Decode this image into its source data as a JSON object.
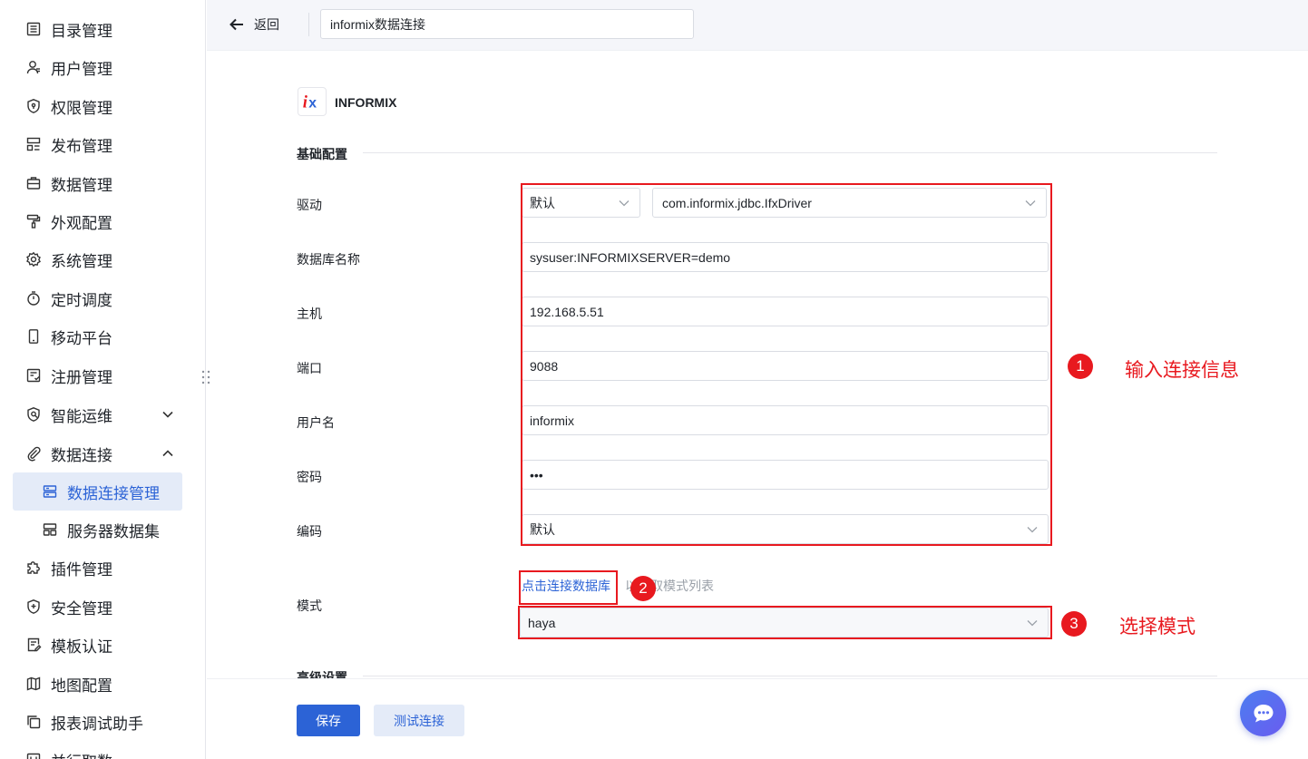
{
  "sidebar": {
    "items": [
      {
        "label": "目录管理",
        "icon": "list-icon"
      },
      {
        "label": "用户管理",
        "icon": "user-icon"
      },
      {
        "label": "权限管理",
        "icon": "shield-icon"
      },
      {
        "label": "发布管理",
        "icon": "layout-icon"
      },
      {
        "label": "数据管理",
        "icon": "briefcase-icon"
      },
      {
        "label": "外观配置",
        "icon": "paint-roller-icon"
      },
      {
        "label": "系统管理",
        "icon": "gear-icon"
      },
      {
        "label": "定时调度",
        "icon": "stopwatch-icon"
      },
      {
        "label": "移动平台",
        "icon": "mobile-icon"
      },
      {
        "label": "注册管理",
        "icon": "register-icon"
      },
      {
        "label": "智能运维",
        "icon": "ops-icon"
      },
      {
        "label": "数据连接",
        "icon": "paperclip-icon"
      },
      {
        "label": "数据连接管理",
        "icon": "server-icon"
      },
      {
        "label": "服务器数据集",
        "icon": "dataset-icon"
      },
      {
        "label": "插件管理",
        "icon": "puzzle-icon"
      },
      {
        "label": "安全管理",
        "icon": "shield-plus-icon"
      },
      {
        "label": "模板认证",
        "icon": "certificate-icon"
      },
      {
        "label": "地图配置",
        "icon": "map-icon"
      },
      {
        "label": "报表调试助手",
        "icon": "copy-icon"
      },
      {
        "label": "并行取数",
        "icon": "parallel-icon"
      }
    ]
  },
  "topbar": {
    "back_label": "返回",
    "connection_name": "informix数据连接"
  },
  "db": {
    "name": "INFORMIX",
    "logo_text": "ix"
  },
  "sections": {
    "basic": "基础配置",
    "advanced": "高级设置"
  },
  "form": {
    "driver_label": "驱动",
    "driver_mode": "默认",
    "driver_class": "com.informix.jdbc.IfxDriver",
    "dbname_label": "数据库名称",
    "dbname_value": "sysuser:INFORMIXSERVER=demo",
    "host_label": "主机",
    "host_value": "192.168.5.51",
    "port_label": "端口",
    "port_value": "9088",
    "username_label": "用户名",
    "username_value": "informix",
    "password_label": "密码",
    "password_value": "•••",
    "encoding_label": "编码",
    "encoding_value": "默认",
    "schema_label": "模式",
    "connect_link": "点击连接数据库",
    "hint": "以获取模式列表",
    "schema_value": "haya"
  },
  "annotations": {
    "step1": "1",
    "step1_text": "输入连接信息",
    "step2": "2",
    "step3": "3",
    "step3_text": "选择模式",
    "color": "#e8191f"
  },
  "footer": {
    "save_label": "保存",
    "test_label": "测试连接"
  },
  "colors": {
    "accent": "#2c63d6",
    "active_bg": "#e4ebf8"
  }
}
